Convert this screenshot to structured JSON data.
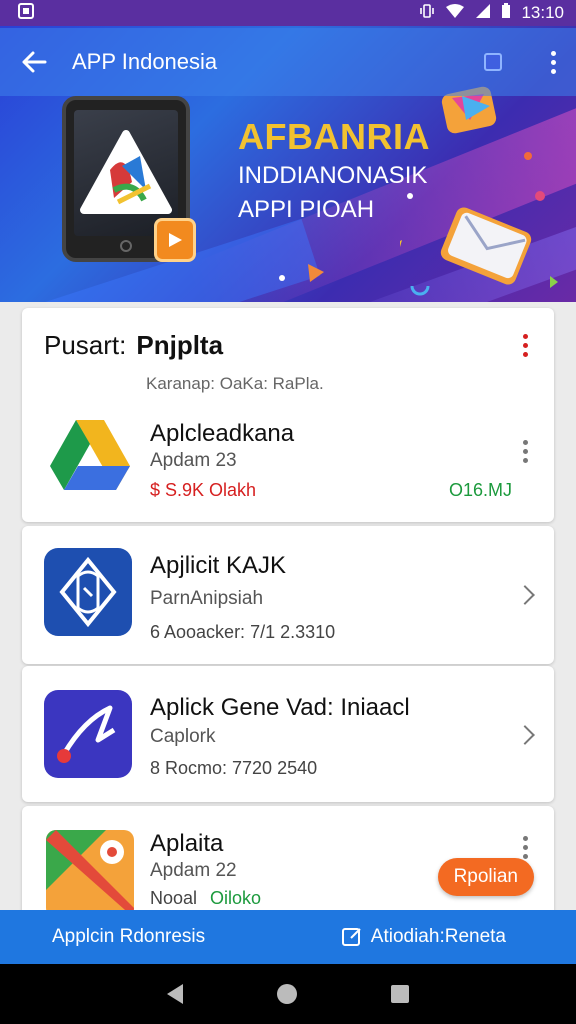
{
  "status_bar": {
    "time": "13:10"
  },
  "app_bar": {
    "title": "APP Indonesia"
  },
  "hero": {
    "line1": "AFBANRIA",
    "line2": "INDDIANONASIK",
    "line3": "APPI PIOAH"
  },
  "section": {
    "label": "Pusart:",
    "name": "Pnjplta",
    "subtitle": "Karanap: OaKa: RaPla."
  },
  "apps": [
    {
      "title": "Aplcleadkana",
      "subtitle": "Apdam 23",
      "meta_left": "$ S.9K  Olakh",
      "meta_right": "O16.MJ"
    },
    {
      "title": "Apjlicit KAJK",
      "subtitle": "ParnAnipsiah",
      "meta": "6 Aooacker: 7/1 2.3310"
    },
    {
      "title": "Aplick Gene Vad: Iniaacl",
      "subtitle": "Caplork",
      "meta": "8 Rocmo:  7720 2540"
    },
    {
      "title": "Aplaita",
      "subtitle": "Apdam 22",
      "meta_left": "Nooal",
      "meta_right": "Oiloko",
      "action": "Rpolian"
    }
  ],
  "bottom_bar": {
    "left": "Applcin Rdonresis",
    "right": "Atiodiah:Reneta"
  },
  "colors": {
    "accent": "#1f77e0",
    "status_red": "#d62020",
    "status_green": "#1c9a3d",
    "pill": "#f36a22",
    "hero_gold": "#f2c230"
  }
}
